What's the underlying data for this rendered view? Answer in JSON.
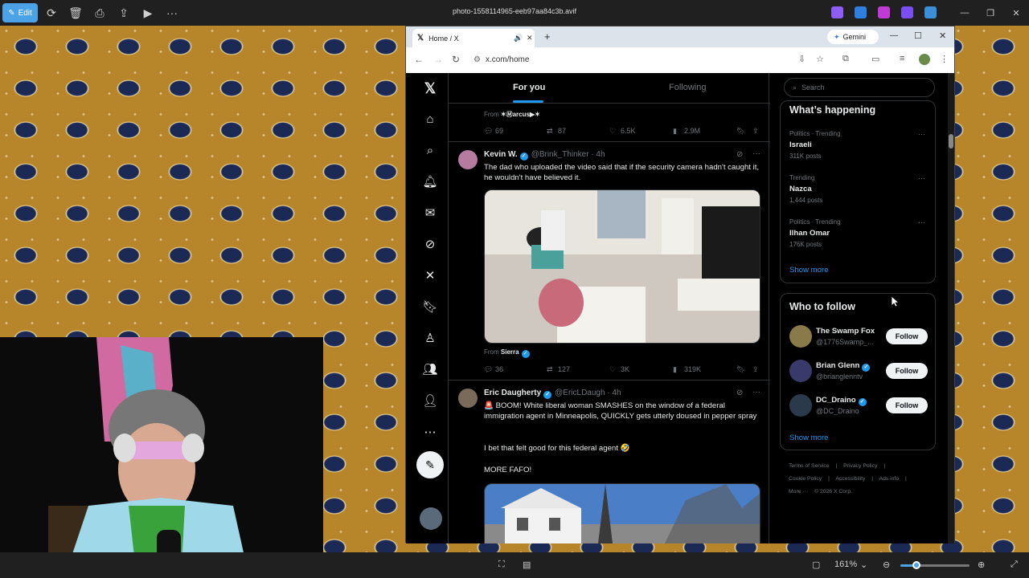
{
  "viewer": {
    "edit_label": "Edit",
    "file_title": "photo-1558114965-eeb97aa84c3b.avif",
    "zoom": "161%"
  },
  "browser": {
    "tab_title": "Home / X",
    "gemini_label": "Gemini",
    "url": "x.com/home"
  },
  "feed": {
    "tabs": [
      {
        "label": "For you"
      },
      {
        "label": "Following"
      }
    ],
    "first_from_prefix": "From",
    "first_from_name": "✶Ⓜarcus▶✶",
    "first_stats": {
      "replies": "69",
      "reposts": "87",
      "likes": "6.5K",
      "views": "2.9M"
    },
    "tweets": [
      {
        "name": "Kevin W.",
        "handle": "@Brink_Thinker · 4h",
        "text": "The dad who uploaded the video said that if the security camera hadn't caught it, he wouldn't have believed it.",
        "from_prefix": "From",
        "from_name": "Sierra",
        "stats": {
          "replies": "36",
          "reposts": "127",
          "likes": "3K",
          "views": "319K"
        }
      },
      {
        "name": "Eric Daugherty",
        "handle": "@EricLDaugh · 4h",
        "text": "🚨 BOOM! White liberal woman SMASHES on the window of a federal immigration agent in Minneapolis, QUICKLY gets utterly doused in pepper spray",
        "text2": "I bet that felt good for this federal agent 🤣",
        "text3": "MORE FAFO!"
      }
    ]
  },
  "sidebar": {
    "search_placeholder": "Search",
    "happening_title": "What’s happening",
    "trends": [
      {
        "context": "Politics · Trending",
        "name": "Israeli",
        "count": "311K posts"
      },
      {
        "context": "Trending",
        "name": "Nazca",
        "count": "1,444 posts"
      },
      {
        "context": "Politics · Trending",
        "name": "Ilhan Omar",
        "count": "176K posts"
      }
    ],
    "show_more": "Show more",
    "follow_title": "Who to follow",
    "follow": [
      {
        "name": "The Swamp Fox",
        "handle": "@1776Swamp_...",
        "button": "Follow"
      },
      {
        "name": "Brian Glenn",
        "handle": "@brianglenntv",
        "button": "Follow"
      },
      {
        "name": "DC_Draino",
        "handle": "@DC_Draino",
        "button": "Follow"
      }
    ],
    "show_more_2": "Show more",
    "footer_links": [
      "Terms of Service",
      "|",
      "Privacy Policy",
      "|",
      "Cookie Policy",
      "|",
      "Accessibility",
      "|",
      "Ads info",
      "|",
      "More ···",
      "© 2026 X Corp."
    ]
  }
}
